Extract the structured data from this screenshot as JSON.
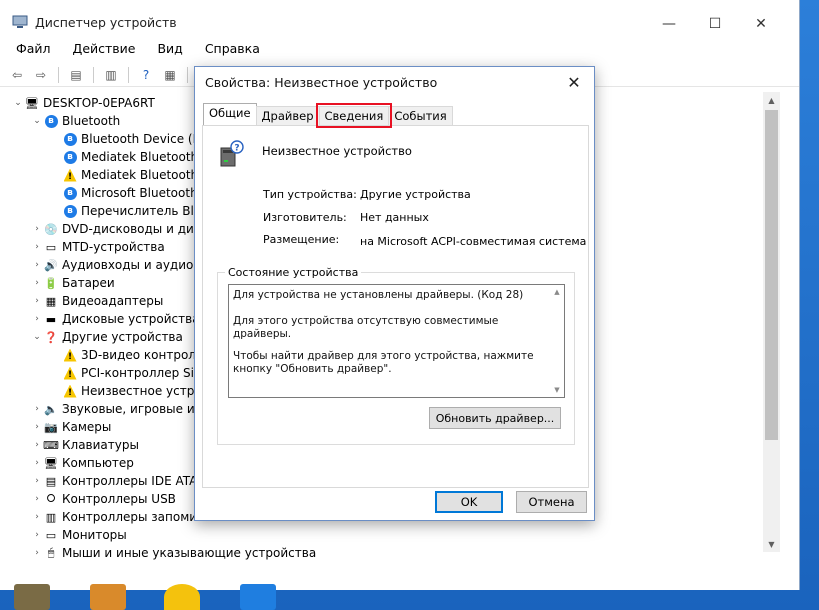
{
  "window": {
    "title": "Диспетчер устройств",
    "minimize": "—",
    "maximize": "☐",
    "close": "✕"
  },
  "menu": [
    "Файл",
    "Действие",
    "Вид",
    "Справка"
  ],
  "tree": {
    "root": "DESKTOP-0EPA6RT",
    "items": [
      {
        "label": "Bluetooth",
        "level": 1,
        "expander": "⌄",
        "icon": "bluetooth-icon"
      },
      {
        "label": "Bluetooth Device (RF",
        "level": 2,
        "expander": "",
        "icon": "bluetooth-icon"
      },
      {
        "label": "Mediatek Bluetooth",
        "level": 2,
        "expander": "",
        "icon": "bluetooth-icon"
      },
      {
        "label": "Mediatek Bluetooth",
        "level": 2,
        "expander": "",
        "icon": "bluetooth-warning-icon"
      },
      {
        "label": "Microsoft Bluetooth",
        "level": 2,
        "expander": "",
        "icon": "bluetooth-icon"
      },
      {
        "label": "Перечислитель Blu",
        "level": 2,
        "expander": "",
        "icon": "bluetooth-icon"
      },
      {
        "label": "DVD-дисководы и диск",
        "level": 1,
        "expander": "›",
        "icon": "dvd-icon"
      },
      {
        "label": "MTD-устройства",
        "level": 1,
        "expander": "›",
        "icon": "mtd-icon"
      },
      {
        "label": "Аудиовходы и аудиовы",
        "level": 1,
        "expander": "›",
        "icon": "audio-icon"
      },
      {
        "label": "Батареи",
        "level": 1,
        "expander": "›",
        "icon": "battery-icon"
      },
      {
        "label": "Видеоадаптеры",
        "level": 1,
        "expander": "›",
        "icon": "display-adapter-icon"
      },
      {
        "label": "Дисковые устройства",
        "level": 1,
        "expander": "›",
        "icon": "disk-icon"
      },
      {
        "label": "Другие устройства",
        "level": 1,
        "expander": "⌄",
        "icon": "other-devices-icon"
      },
      {
        "label": "3D-видео контролл",
        "level": 2,
        "expander": "",
        "icon": "warning-device-icon"
      },
      {
        "label": "PCI-контроллер Sin",
        "level": 2,
        "expander": "",
        "icon": "warning-device-icon"
      },
      {
        "label": "Неизвестное устро",
        "level": 2,
        "expander": "",
        "icon": "warning-device-icon"
      },
      {
        "label": "Звуковые, игровые и в",
        "level": 1,
        "expander": "›",
        "icon": "sound-icon"
      },
      {
        "label": "Камеры",
        "level": 1,
        "expander": "›",
        "icon": "camera-icon"
      },
      {
        "label": "Клавиатуры",
        "level": 1,
        "expander": "›",
        "icon": "keyboard-icon"
      },
      {
        "label": "Компьютер",
        "level": 1,
        "expander": "›",
        "icon": "computer-icon"
      },
      {
        "label": "Контроллеры IDE ATA/",
        "level": 1,
        "expander": "›",
        "icon": "ide-icon"
      },
      {
        "label": "Контроллеры USB",
        "level": 1,
        "expander": "›",
        "icon": "usb-icon"
      },
      {
        "label": "Контроллеры запомин",
        "level": 1,
        "expander": "›",
        "icon": "storage-icon"
      },
      {
        "label": "Мониторы",
        "level": 1,
        "expander": "›",
        "icon": "monitor-icon"
      },
      {
        "label": "Мыши и иные указывающие устройства",
        "level": 1,
        "expander": "›",
        "icon": "mouse-icon"
      }
    ]
  },
  "dialog": {
    "title": "Свойства: Неизвестное устройство",
    "close": "✕",
    "tabs": [
      {
        "label": "Общие",
        "active": true
      },
      {
        "label": "Драйвер",
        "active": false
      },
      {
        "label": "Сведения",
        "active": false,
        "highlighted": true
      },
      {
        "label": "События",
        "active": false
      }
    ],
    "device_name": "Неизвестное устройство",
    "properties": [
      {
        "label": "Тип устройства:",
        "value": "Другие устройства"
      },
      {
        "label": "Изготовитель:",
        "value": "Нет данных"
      },
      {
        "label": "Размещение:",
        "value": "на Microsoft ACPI-совместимая система"
      }
    ],
    "status_group_title": "Состояние устройства",
    "status_lines": [
      "Для устройства не установлены драйверы. (Код 28)",
      "Для этого устройства отсутствую совместимые драйверы.",
      "Чтобы найти драйвер для этого устройства, нажмите кнопку \"Обновить драйвер\"."
    ],
    "update_button": "Обновить драйвер...",
    "ok_button": "OK",
    "cancel_button": "Отмена"
  },
  "colors": {
    "highlight_box": "#e81123",
    "default_button_border": "#0078d7",
    "bluetooth": "#1e7be6",
    "warning": "#f7c600"
  }
}
